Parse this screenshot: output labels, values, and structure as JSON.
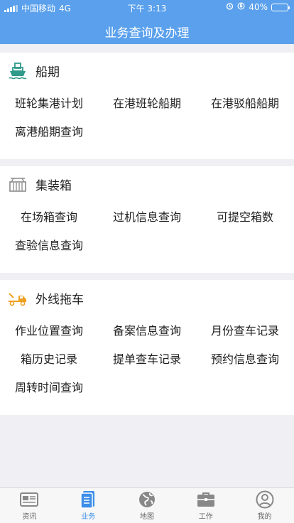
{
  "status_bar": {
    "carrier": "中国移动",
    "network": "4G",
    "time": "下午 3:13",
    "battery_percent": "40%",
    "battery_level": 0.4
  },
  "header": {
    "title": "业务查询及办理"
  },
  "sections": [
    {
      "icon": "ship-icon",
      "title": "船期",
      "items": [
        "班轮集港计划",
        "在港班轮船期",
        "在港驳船船期",
        "离港船期查询"
      ]
    },
    {
      "icon": "container-icon",
      "title": "集装箱",
      "items": [
        "在场箱查询",
        "过机信息查询",
        "可提空箱数",
        "查验信息查询"
      ]
    },
    {
      "icon": "tow-truck-icon",
      "title": "外线拖车",
      "items": [
        "作业位置查询",
        "备案信息查询",
        "月份查车记录",
        "箱历史记录",
        "提单查车记录",
        "预约信息查询",
        "周转时间查询"
      ]
    }
  ],
  "tabbar": {
    "tabs": [
      {
        "label": "资讯",
        "icon": "news-icon",
        "active": false
      },
      {
        "label": "业务",
        "icon": "business-icon",
        "active": true
      },
      {
        "label": "地图",
        "icon": "globe-icon",
        "active": false
      },
      {
        "label": "工作",
        "icon": "briefcase-icon",
        "active": false
      },
      {
        "label": "我的",
        "icon": "user-icon",
        "active": false
      }
    ]
  },
  "colors": {
    "header_bg": "#5aa0ec",
    "tab_active": "#3d8ee8",
    "ship_icon": "#2f9a8a",
    "container_icon": "#8a8a8a",
    "truck_icon": "#f0a020"
  }
}
